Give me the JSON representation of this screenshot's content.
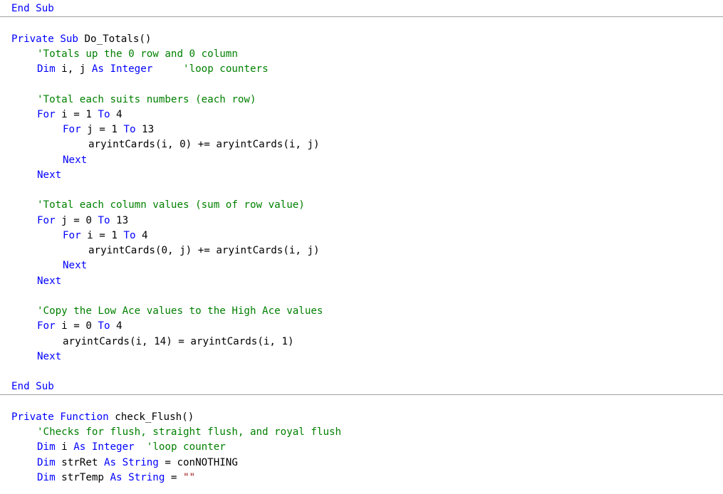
{
  "editor": {
    "language": "Visual Basic",
    "colors": {
      "keyword": "#0000ff",
      "comment": "#008000",
      "string": "#a31515",
      "text": "#000000",
      "separator": "#a0a0a0"
    },
    "lines": [
      {
        "indent": 0,
        "tokens": [
          {
            "t": "kw",
            "v": "End Sub"
          }
        ]
      },
      {
        "separator": true
      },
      {
        "blank": true
      },
      {
        "indent": 0,
        "tokens": [
          {
            "t": "kw",
            "v": "Private Sub "
          },
          {
            "t": "id",
            "v": "Do_Totals()"
          }
        ]
      },
      {
        "indent": 1,
        "tokens": [
          {
            "t": "cm",
            "v": "'Totals up the 0 row and 0 column"
          }
        ]
      },
      {
        "indent": 1,
        "tokens": [
          {
            "t": "kw",
            "v": "Dim "
          },
          {
            "t": "id",
            "v": "i, j "
          },
          {
            "t": "kw",
            "v": "As Integer"
          },
          {
            "t": "id",
            "v": "     "
          },
          {
            "t": "cm",
            "v": "'loop counters"
          }
        ]
      },
      {
        "blank": true
      },
      {
        "indent": 1,
        "tokens": [
          {
            "t": "cm",
            "v": "'Total each suits numbers (each row)"
          }
        ]
      },
      {
        "indent": 1,
        "tokens": [
          {
            "t": "kw",
            "v": "For "
          },
          {
            "t": "id",
            "v": "i = 1 "
          },
          {
            "t": "kw",
            "v": "To "
          },
          {
            "t": "id",
            "v": "4"
          }
        ]
      },
      {
        "indent": 2,
        "tokens": [
          {
            "t": "kw",
            "v": "For "
          },
          {
            "t": "id",
            "v": "j = 1 "
          },
          {
            "t": "kw",
            "v": "To "
          },
          {
            "t": "id",
            "v": "13"
          }
        ]
      },
      {
        "indent": 3,
        "tokens": [
          {
            "t": "id",
            "v": "aryintCards(i, 0) += aryintCards(i, j)"
          }
        ]
      },
      {
        "indent": 2,
        "tokens": [
          {
            "t": "kw",
            "v": "Next"
          }
        ]
      },
      {
        "indent": 1,
        "tokens": [
          {
            "t": "kw",
            "v": "Next"
          }
        ]
      },
      {
        "blank": true
      },
      {
        "indent": 1,
        "tokens": [
          {
            "t": "cm",
            "v": "'Total each column values (sum of row value)"
          }
        ]
      },
      {
        "indent": 1,
        "tokens": [
          {
            "t": "kw",
            "v": "For "
          },
          {
            "t": "id",
            "v": "j = 0 "
          },
          {
            "t": "kw",
            "v": "To "
          },
          {
            "t": "id",
            "v": "13"
          }
        ]
      },
      {
        "indent": 2,
        "tokens": [
          {
            "t": "kw",
            "v": "For "
          },
          {
            "t": "id",
            "v": "i = 1 "
          },
          {
            "t": "kw",
            "v": "To "
          },
          {
            "t": "id",
            "v": "4"
          }
        ]
      },
      {
        "indent": 3,
        "tokens": [
          {
            "t": "id",
            "v": "aryintCards(0, j) += aryintCards(i, j)"
          }
        ]
      },
      {
        "indent": 2,
        "tokens": [
          {
            "t": "kw",
            "v": "Next"
          }
        ]
      },
      {
        "indent": 1,
        "tokens": [
          {
            "t": "kw",
            "v": "Next"
          }
        ]
      },
      {
        "blank": true
      },
      {
        "indent": 1,
        "tokens": [
          {
            "t": "cm",
            "v": "'Copy the Low Ace values to the High Ace values"
          }
        ]
      },
      {
        "indent": 1,
        "tokens": [
          {
            "t": "kw",
            "v": "For "
          },
          {
            "t": "id",
            "v": "i = 0 "
          },
          {
            "t": "kw",
            "v": "To "
          },
          {
            "t": "id",
            "v": "4"
          }
        ]
      },
      {
        "indent": 2,
        "tokens": [
          {
            "t": "id",
            "v": "aryintCards(i, 14) = aryintCards(i, 1)"
          }
        ]
      },
      {
        "indent": 1,
        "tokens": [
          {
            "t": "kw",
            "v": "Next"
          }
        ]
      },
      {
        "blank": true
      },
      {
        "indent": 0,
        "tokens": [
          {
            "t": "kw",
            "v": "End Sub"
          }
        ]
      },
      {
        "separator": true
      },
      {
        "blank": true
      },
      {
        "indent": 0,
        "tokens": [
          {
            "t": "kw",
            "v": "Private Function "
          },
          {
            "t": "id",
            "v": "check_Flush()"
          }
        ]
      },
      {
        "indent": 1,
        "tokens": [
          {
            "t": "cm",
            "v": "'Checks for flush, straight flush, and royal flush"
          }
        ]
      },
      {
        "indent": 1,
        "tokens": [
          {
            "t": "kw",
            "v": "Dim "
          },
          {
            "t": "id",
            "v": "i "
          },
          {
            "t": "kw",
            "v": "As Integer"
          },
          {
            "t": "id",
            "v": "  "
          },
          {
            "t": "cm",
            "v": "'loop counter"
          }
        ]
      },
      {
        "indent": 1,
        "tokens": [
          {
            "t": "kw",
            "v": "Dim "
          },
          {
            "t": "id",
            "v": "strRet "
          },
          {
            "t": "kw",
            "v": "As String"
          },
          {
            "t": "id",
            "v": " = conNOTHING"
          }
        ]
      },
      {
        "indent": 1,
        "tokens": [
          {
            "t": "kw",
            "v": "Dim "
          },
          {
            "t": "id",
            "v": "strTemp "
          },
          {
            "t": "kw",
            "v": "As String"
          },
          {
            "t": "id",
            "v": " = "
          },
          {
            "t": "st",
            "v": "\"\""
          }
        ]
      }
    ]
  }
}
